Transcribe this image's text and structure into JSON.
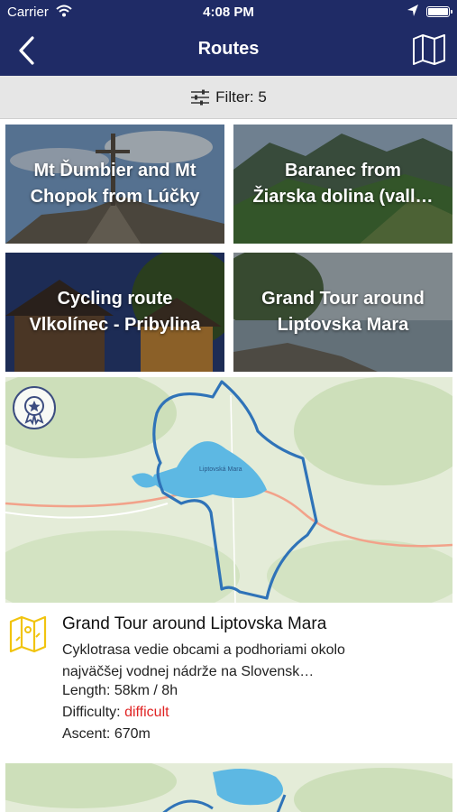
{
  "status_bar": {
    "carrier": "Carrier",
    "time": "4:08 PM"
  },
  "nav": {
    "title": "Routes",
    "back_icon": "chevron-left-icon",
    "map_icon": "map-icon"
  },
  "filter": {
    "label": "Filter: 5",
    "icon": "sliders-icon"
  },
  "tiles": [
    {
      "line1": "Mt Ďumbier and Mt",
      "line2": "Chopok from Lúčky"
    },
    {
      "line1": "Baranec from",
      "line2": "Žiarska dolina (vall…"
    },
    {
      "line1": "Cycling route",
      "line2": "Vlkolínec - Pribylina"
    },
    {
      "line1": "Grand Tour around",
      "line2": "Liptovska Mara"
    }
  ],
  "featured": {
    "title": "Grand Tour around Liptovska Mara",
    "description_line1": "Cyklotrasa vedie obcami  a podhoriami  okolo",
    "description_line2": "najväčšej vodnej nádrže na Slovensk…",
    "length_label": "Length:",
    "length_value": "58km / 8h",
    "difficulty_label": "Difficulty:",
    "difficulty_value": "difficult",
    "ascent_label": "Ascent:",
    "ascent_value": "670m",
    "map_lake_label": "Liptovská Mara",
    "difficulty_color": "#e02424"
  },
  "colors": {
    "header": "#1f2b66",
    "route": "#2f73b8",
    "lake": "#5db8e3"
  }
}
